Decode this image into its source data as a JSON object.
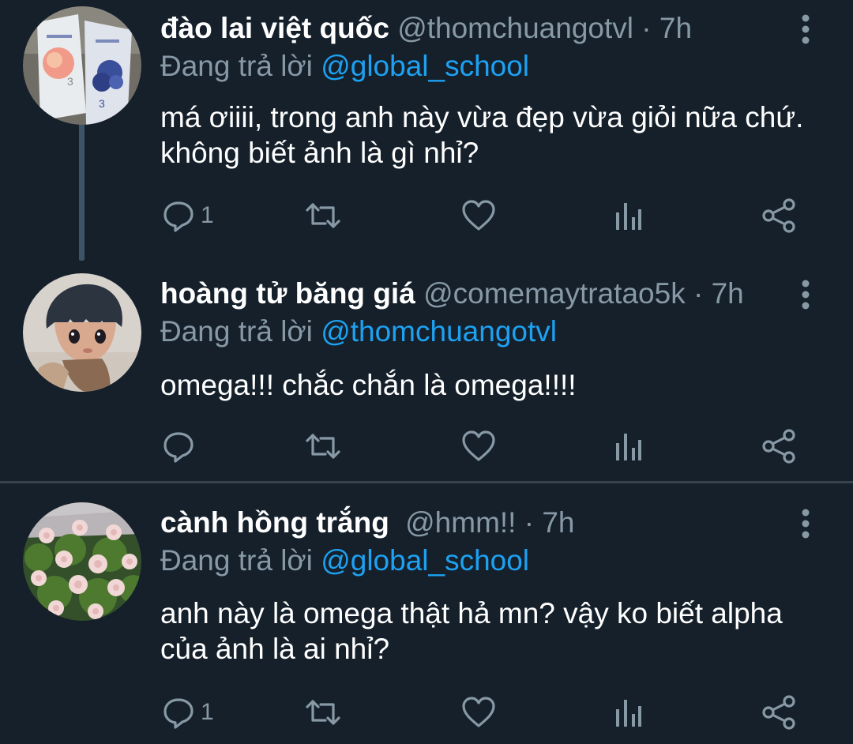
{
  "tweets": [
    {
      "display_name": "đào lai việt quốc",
      "handle": "@thomchuangotvl",
      "separator": "·",
      "time": "7h",
      "reply_label": "Đang trả lời",
      "reply_to": "@global_school",
      "text": "má ơiiii, trong anh này vừa đẹp vừa giỏi nữa chứ. không biết ảnh là gì nhỉ?",
      "reply_count": "1",
      "avatar": "yogurt-pouches-photo"
    },
    {
      "display_name": "hoàng tử băng giá",
      "handle": "@comemaytratao5k",
      "separator": "·",
      "time": "7h",
      "reply_label": "Đang trả lời",
      "reply_to": "@thomchuangotvl",
      "text": "omega!!! chắc chắn là omega!!!!",
      "reply_count": "",
      "avatar": "figurine-photo"
    },
    {
      "display_name": "cành hồng trắng",
      "handle": "@hmm!!",
      "separator": "·",
      "time": "7h",
      "reply_label": "Đang trả lời",
      "reply_to": "@global_school",
      "text": "anh này là omega thật hả mn? vậy ko biết alpha của ảnh là ai nhỉ?",
      "reply_count": "1",
      "avatar": "white-roses-photo"
    }
  ],
  "icons": {
    "reply": "reply-icon",
    "retweet": "retweet-icon",
    "like": "heart-icon",
    "analytics": "analytics-icon",
    "share": "share-icon",
    "more": "more-vertical-icon"
  },
  "colors": {
    "background": "#15202b",
    "text": "#ffffff",
    "muted": "#8899a6",
    "link": "#1da1f2",
    "divider": "#38444d",
    "thread_line": "#3d5466"
  }
}
